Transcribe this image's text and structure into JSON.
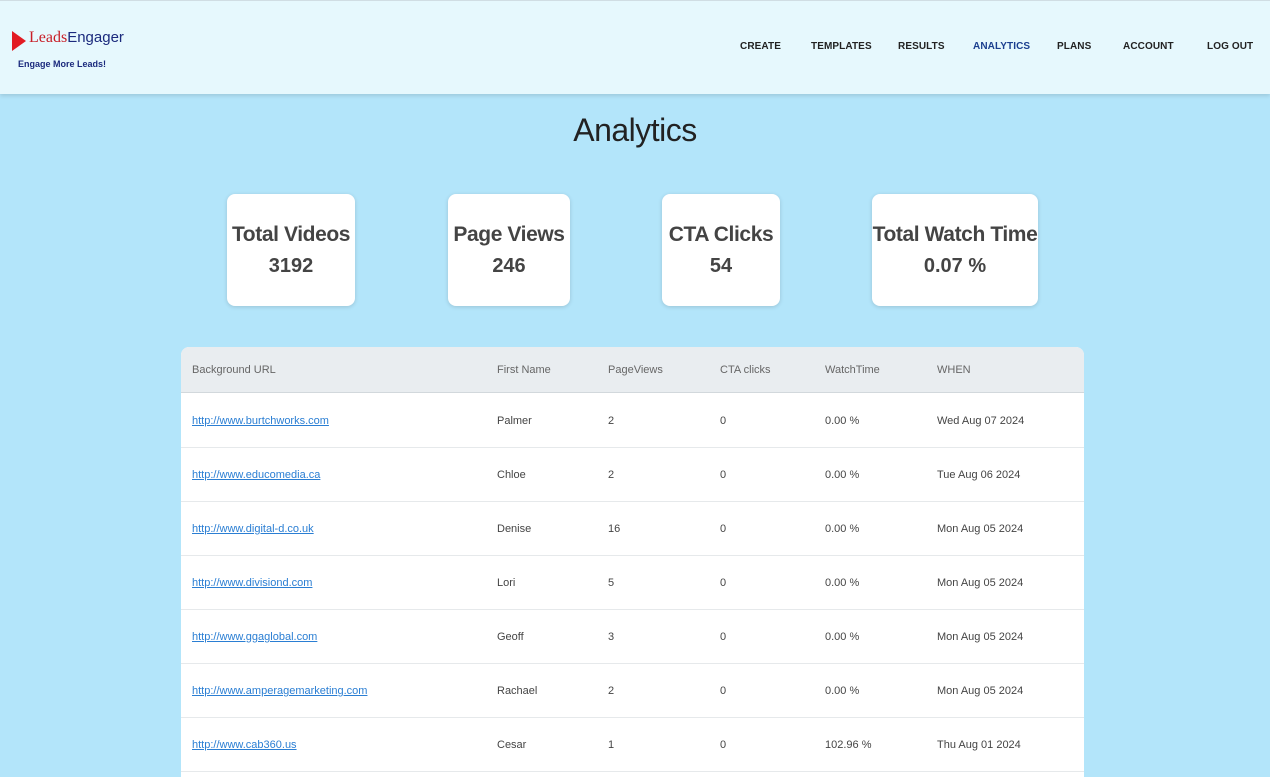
{
  "brand": {
    "name_part1": "Leads",
    "name_part2": "Engager",
    "tagline": "Engage More Leads!"
  },
  "nav": {
    "items": [
      {
        "label": "CREATE",
        "active": false
      },
      {
        "label": "TEMPLATES",
        "active": false
      },
      {
        "label": "RESULTS",
        "active": false
      },
      {
        "label": "ANALYTICS",
        "active": true
      },
      {
        "label": "PLANS",
        "active": false
      },
      {
        "label": "ACCOUNT",
        "active": false
      },
      {
        "label": "LOG OUT",
        "active": false
      }
    ]
  },
  "page": {
    "title": "Analytics"
  },
  "stats": [
    {
      "label": "Total Videos",
      "value": "3192"
    },
    {
      "label": "Page Views",
      "value": "246"
    },
    {
      "label": "CTA Clicks",
      "value": "54"
    },
    {
      "label": "Total Watch Time",
      "value": "0.07 %"
    }
  ],
  "table": {
    "headers": [
      "Background URL",
      "First Name",
      "PageViews",
      "CTA clicks",
      "WatchTime",
      "WHEN"
    ],
    "rows": [
      {
        "url": "http://www.burtchworks.com",
        "first_name": "Palmer",
        "page_views": "2",
        "cta_clicks": "0",
        "watch_time": "0.00 %",
        "when": "Wed Aug 07 2024"
      },
      {
        "url": "http://www.educomedia.ca",
        "first_name": "Chloe",
        "page_views": "2",
        "cta_clicks": "0",
        "watch_time": "0.00 %",
        "when": "Tue Aug 06 2024"
      },
      {
        "url": "http://www.digital-d.co.uk",
        "first_name": "Denise",
        "page_views": "16",
        "cta_clicks": "0",
        "watch_time": "0.00 %",
        "when": "Mon Aug 05 2024"
      },
      {
        "url": "http://www.divisiond.com",
        "first_name": "Lori",
        "page_views": "5",
        "cta_clicks": "0",
        "watch_time": "0.00 %",
        "when": "Mon Aug 05 2024"
      },
      {
        "url": "http://www.ggaglobal.com",
        "first_name": "Geoff",
        "page_views": "3",
        "cta_clicks": "0",
        "watch_time": "0.00 %",
        "when": "Mon Aug 05 2024"
      },
      {
        "url": "http://www.amperagemarketing.com",
        "first_name": "Rachael",
        "page_views": "2",
        "cta_clicks": "0",
        "watch_time": "0.00 %",
        "when": "Mon Aug 05 2024"
      },
      {
        "url": "http://www.cab360.us",
        "first_name": "Cesar",
        "page_views": "1",
        "cta_clicks": "0",
        "watch_time": "102.96 %",
        "when": "Thu Aug 01 2024"
      }
    ]
  },
  "colors": {
    "page_background": "#b3e5fa",
    "header_background": "#e6f8fd",
    "active_nav": "#1b3f8f",
    "link": "#2a7ed3",
    "logo_red": "#e21b23",
    "logo_navy": "#1b2a7d"
  }
}
